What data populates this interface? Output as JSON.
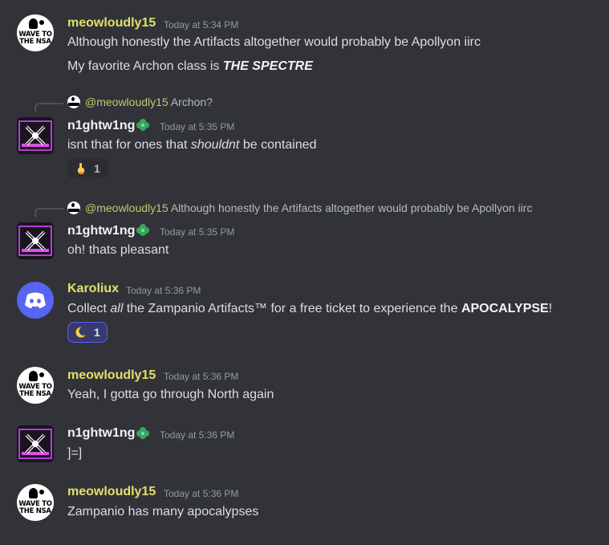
{
  "messages": [
    {
      "author": "meowloudly15",
      "timestamp": "Today at 5:34 PM",
      "avatar_text": "WAVE TO THE NSA",
      "lines": [
        "Although honestly the Artifacts altogether would probably be Apollyon iirc",
        "My favorite Archon class is"
      ],
      "bold_italic": "THE SPECTRE"
    },
    {
      "reply_to": "@meowloudly15",
      "reply_text": "Archon?",
      "author": "n1ghtw1ng",
      "timestamp": "Today at 5:35 PM",
      "text_before": "isnt that for ones that",
      "text_italic": "shouldnt",
      "text_after": "be contained",
      "reaction": {
        "emoji": "point-up-icon",
        "count": "1"
      }
    },
    {
      "reply_to": "@meowloudly15",
      "reply_text": "Although honestly the Artifacts altogether would probably be Apollyon iirc",
      "author": "n1ghtw1ng",
      "timestamp": "Today at 5:35 PM",
      "text": "oh! thats pleasant"
    },
    {
      "author": "Karoliux",
      "timestamp": "Today at 5:36 PM",
      "text_before": "Collect",
      "text_italic": "all",
      "text_middle": "the Zampanio Artifacts™ for a free ticket to experience the",
      "text_bold": "APOCALYPSE",
      "text_after": "!",
      "reaction": {
        "emoji": "crescent-moon-icon",
        "count": "1"
      }
    },
    {
      "author": "meowloudly15",
      "timestamp": "Today at 5:36 PM",
      "avatar_text": "WAVE TO THE NSA",
      "text": "Yeah, I gotta go through North again"
    },
    {
      "author": "n1ghtw1ng",
      "timestamp": "Today at 5:36 PM",
      "text": "]=]"
    },
    {
      "author": "meowloudly15",
      "timestamp": "Today at 5:36 PM",
      "avatar_text": "WAVE TO THE NSA",
      "text": "Zampanio has many apocalypses"
    }
  ],
  "colors": {
    "background": "#313338",
    "username_yellow": "#e1e06a",
    "text": "#dbdee1",
    "timestamp": "#949ba4",
    "badge_green": "#3ba55d",
    "reaction_active_border": "#5865f2"
  }
}
